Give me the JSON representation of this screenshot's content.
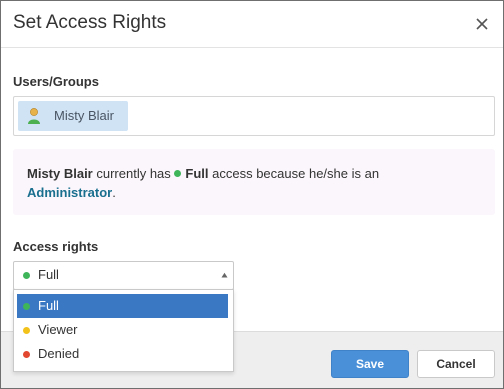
{
  "dialog": {
    "title": "Set Access Rights",
    "close_icon": "close-icon"
  },
  "users": {
    "label": "Users/Groups",
    "items": [
      {
        "name": "Misty Blair",
        "icon": "user-icon"
      }
    ]
  },
  "info": {
    "user": "Misty Blair",
    "text_1": " currently has ",
    "access": "Full",
    "text_2": " access because he/she is an",
    "role": "Administrator",
    "text_3": "."
  },
  "access_rights": {
    "label": "Access rights",
    "selected": "Full",
    "options": [
      {
        "label": "Full",
        "color": "#3fb55a"
      },
      {
        "label": "Viewer",
        "color": "#f2c21a"
      },
      {
        "label": "Denied",
        "color": "#e2472f"
      }
    ]
  },
  "footer": {
    "save_label": "Save",
    "cancel_label": "Cancel"
  },
  "colors": {
    "accent": "#4a90d9",
    "link": "#1a6f8f",
    "selected_option_bg": "#3b78c4"
  }
}
